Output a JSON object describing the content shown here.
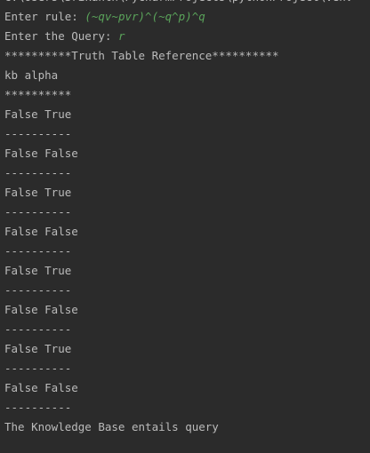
{
  "console": {
    "path_line": "C:\\Users\\Srikanth\\PycharmProjects\\pythonProject\\venv",
    "rule_prompt": "Enter rule: ",
    "rule_input": "(~qv~pvr)^(~q^p)^q",
    "query_prompt": "Enter the Query: ",
    "query_input": "r",
    "header": "**********Truth Table Reference**********",
    "kb_label": "kb alpha",
    "stars": "**********",
    "rows": [
      "False True",
      "----------",
      "False False",
      "----------",
      "False True",
      "----------",
      "False False",
      "----------",
      "False True",
      "----------",
      "False False",
      "----------",
      "False True",
      "----------",
      "False False",
      "----------"
    ],
    "result": "The Knowledge Base entails query"
  },
  "colors": {
    "background": "#2b2b2b",
    "text": "#bbbbbb",
    "user_input": "#5aa35a"
  }
}
